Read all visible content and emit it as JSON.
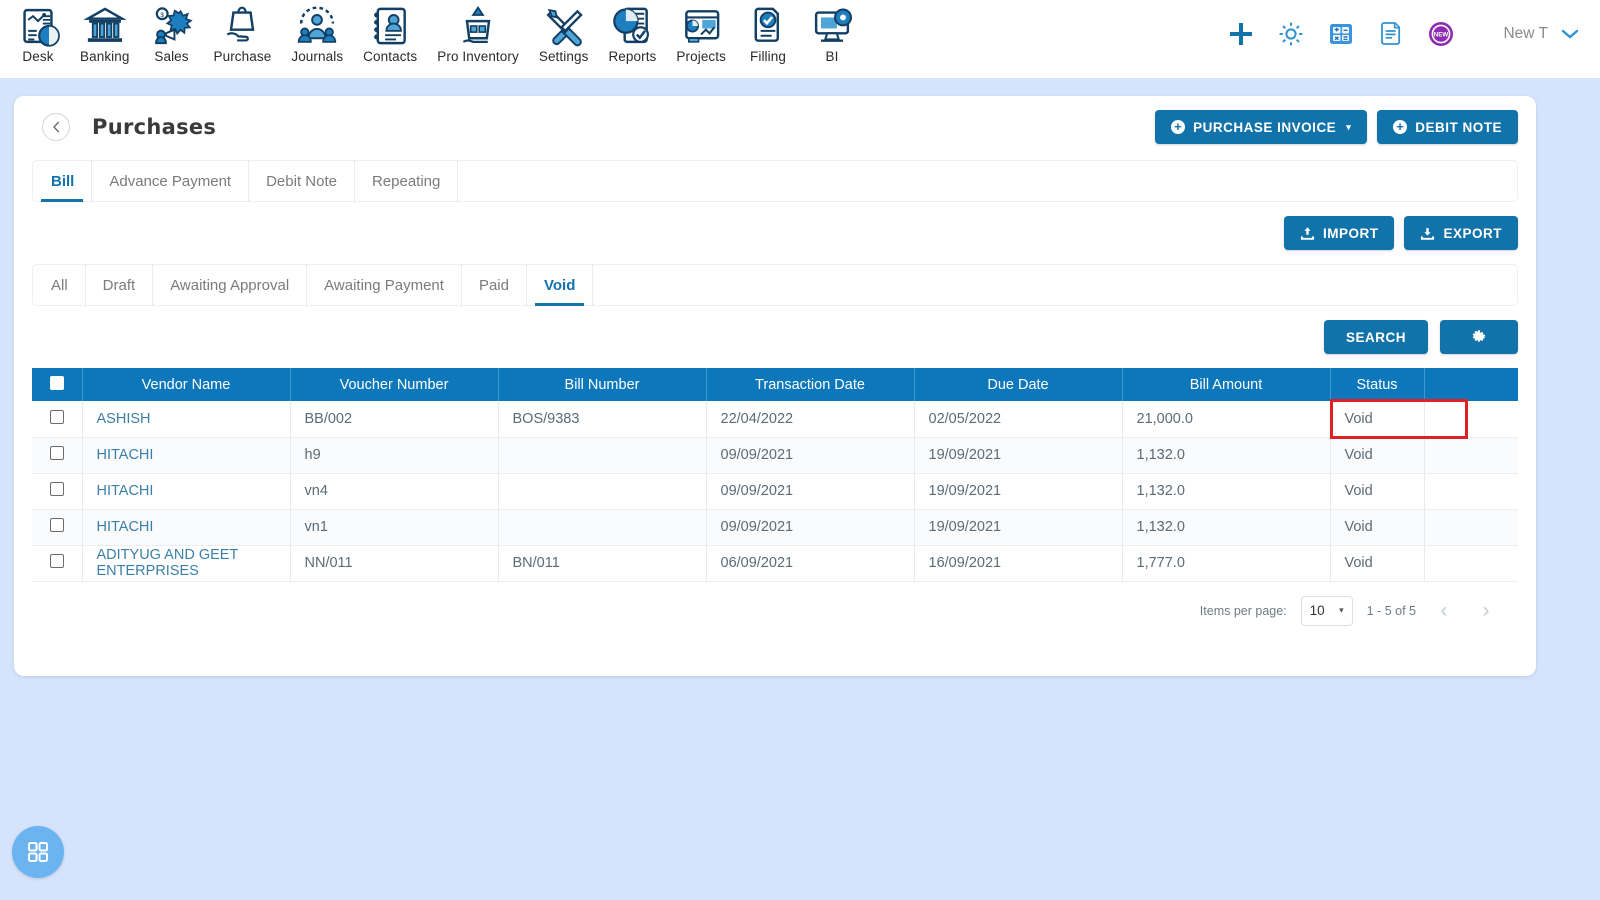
{
  "theme": {
    "page_bg": "#d5e4fb",
    "primary_blue": "#1273ab",
    "table_header_blue": "#0d77bb",
    "link_blue": "#3b7fa8",
    "highlight_red": "#e31f26",
    "fab_blue": "#6cb3f2"
  },
  "topnav": {
    "items": [
      {
        "label": "Desk",
        "icon": "dashboard-icon"
      },
      {
        "label": "Banking",
        "icon": "bank-icon"
      },
      {
        "label": "Sales",
        "icon": "sales-icon"
      },
      {
        "label": "Purchase",
        "icon": "purchase-icon"
      },
      {
        "label": "Journals",
        "icon": "journals-icon"
      },
      {
        "label": "Contacts",
        "icon": "contacts-icon"
      },
      {
        "label": "Pro Inventory",
        "icon": "inventory-icon"
      },
      {
        "label": "Settings",
        "icon": "settings-icon"
      },
      {
        "label": "Reports",
        "icon": "reports-icon"
      },
      {
        "label": "Projects",
        "icon": "projects-icon"
      },
      {
        "label": "Filling",
        "icon": "filling-icon"
      },
      {
        "label": "BI",
        "icon": "bi-icon"
      }
    ],
    "right_icons": [
      {
        "name": "add-icon"
      },
      {
        "name": "gear-icon"
      },
      {
        "name": "calculator-icon"
      },
      {
        "name": "notes-icon"
      },
      {
        "name": "new-badge-icon",
        "badge_text": "NEW"
      }
    ],
    "user": {
      "name": "New T",
      "chevron": "chevron-down-icon"
    }
  },
  "page": {
    "title": "Purchases",
    "back_icon": "chevron-left-icon",
    "primary_actions": [
      {
        "label": "PURCHASE INVOICE",
        "icon": "circle-plus-icon",
        "has_caret": true
      },
      {
        "label": "DEBIT NOTE",
        "icon": "circle-plus-icon",
        "has_caret": false
      }
    ],
    "doc_tabs": [
      {
        "label": "Bill",
        "active": true
      },
      {
        "label": "Advance Payment",
        "active": false
      },
      {
        "label": "Debit Note",
        "active": false
      },
      {
        "label": "Repeating",
        "active": false
      }
    ],
    "io_actions": [
      {
        "label": "IMPORT",
        "icon": "upload-icon"
      },
      {
        "label": "EXPORT",
        "icon": "download-icon"
      }
    ],
    "status_tabs": [
      {
        "label": "All",
        "active": false
      },
      {
        "label": "Draft",
        "active": false
      },
      {
        "label": "Awaiting Approval",
        "active": false
      },
      {
        "label": "Awaiting Payment",
        "active": false
      },
      {
        "label": "Paid",
        "active": false
      },
      {
        "label": "Void",
        "active": true
      }
    ],
    "search": {
      "label": "SEARCH",
      "settings_icon": "gear-icon"
    }
  },
  "table": {
    "select_all_checkbox": false,
    "columns": [
      "Vendor Name",
      "Voucher Number",
      "Bill Number",
      "Transaction Date",
      "Due Date",
      "Bill Amount",
      "Status"
    ],
    "rows": [
      {
        "checked": false,
        "vendor": "ASHISH",
        "voucher": "BB/002",
        "bill_number": "BOS/9383",
        "transaction_date": "22/04/2022",
        "due_date": "02/05/2022",
        "bill_amount": "21,000.0",
        "status": "Void",
        "highlighted": true
      },
      {
        "checked": false,
        "vendor": "HITACHI",
        "voucher": "h9",
        "bill_number": "",
        "transaction_date": "09/09/2021",
        "due_date": "19/09/2021",
        "bill_amount": "1,132.0",
        "status": "Void",
        "highlighted": false
      },
      {
        "checked": false,
        "vendor": "HITACHI",
        "voucher": "vn4",
        "bill_number": "",
        "transaction_date": "09/09/2021",
        "due_date": "19/09/2021",
        "bill_amount": "1,132.0",
        "status": "Void",
        "highlighted": false
      },
      {
        "checked": false,
        "vendor": "HITACHI",
        "voucher": "vn1",
        "bill_number": "",
        "transaction_date": "09/09/2021",
        "due_date": "19/09/2021",
        "bill_amount": "1,132.0",
        "status": "Void",
        "highlighted": false
      },
      {
        "checked": false,
        "vendor": "ADITYUG AND GEET ENTERPRISES",
        "voucher": "NN/011",
        "bill_number": "BN/011",
        "transaction_date": "06/09/2021",
        "due_date": "16/09/2021",
        "bill_amount": "1,777.0",
        "status": "Void",
        "highlighted": false
      }
    ]
  },
  "pagination": {
    "items_per_page_label": "Items per page:",
    "items_per_page_value": "10",
    "range_text": "1 - 5 of 5",
    "prev_icon": "chevron-left-icon",
    "next_icon": "chevron-right-icon"
  },
  "fab": {
    "icon": "grid-apps-icon"
  }
}
